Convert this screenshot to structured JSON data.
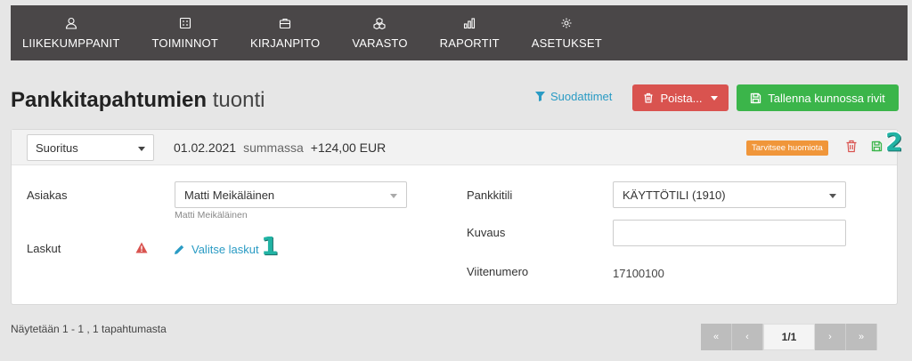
{
  "nav": {
    "items": [
      {
        "label": "LIIKEKUMPPANIT",
        "icon": "person-icon"
      },
      {
        "label": "TOIMINNOT",
        "icon": "calculator-icon"
      },
      {
        "label": "KIRJANPITO",
        "icon": "briefcase-icon"
      },
      {
        "label": "VARASTO",
        "icon": "cubes-icon"
      },
      {
        "label": "RAPORTIT",
        "icon": "bar-chart-icon"
      },
      {
        "label": "ASETUKSET",
        "icon": "gear-icon"
      }
    ]
  },
  "header": {
    "title_bold": "Pankkitapahtumien",
    "title_light": "tuonti",
    "filters_label": "Suodattimet",
    "delete_label": "Poista...",
    "save_all_label": "Tallenna kunnossa rivit"
  },
  "transaction": {
    "type": "Suoritus",
    "date": "01.02.2021",
    "amount_prefix": "summassa",
    "amount": "+124,00 EUR",
    "status_badge": "Tarvitsee huomiota",
    "marker_save": "2"
  },
  "form": {
    "customer_label": "Asiakas",
    "customer_value": "Matti Meikäläinen",
    "customer_helper": "Matti Meikäläinen",
    "invoices_label": "Laskut",
    "pick_invoices_label": "Valitse laskut",
    "marker_pick": "1",
    "bank_account_label": "Pankkitili",
    "bank_account_value": "KÄYTTÖTILI (1910)",
    "description_label": "Kuvaus",
    "description_value": "",
    "reference_label": "Viitenumero",
    "reference_value": "17100100"
  },
  "footer": {
    "showing_text": "Näytetään 1 - 1 , 1 tapahtumasta",
    "pager": {
      "first": "«",
      "prev": "‹",
      "current": "1/1",
      "next": "›",
      "last": "»"
    }
  },
  "colors": {
    "nav_bg": "#4a4748",
    "danger": "#d9534f",
    "success": "#3bb54a",
    "link": "#2a9bc4",
    "warning_badge": "#f0963a",
    "marker": "#21b3a4"
  }
}
